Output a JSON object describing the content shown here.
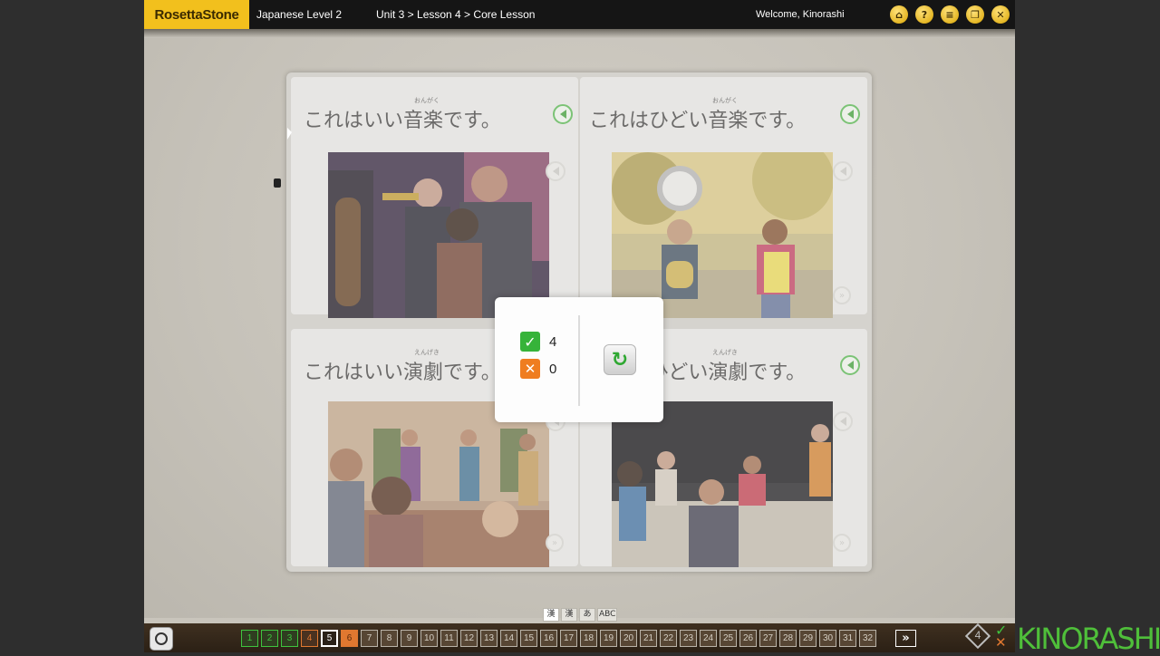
{
  "header": {
    "logo": "RosettaStone",
    "course": "Japanese Level 2",
    "breadcrumb": "Unit 3 > Lesson 4 > Core Lesson",
    "welcome": "Welcome, Kinorashi",
    "icons": [
      "home-icon",
      "help-icon",
      "menu-list-icon",
      "window-icon",
      "close-icon"
    ]
  },
  "cards": [
    {
      "text": "これはいい音楽です。",
      "furigana": "おんがく"
    },
    {
      "text": "これはひどい音楽です。",
      "furigana": "おんがく"
    },
    {
      "text": "これはいい演劇です。",
      "furigana": "えんげき"
    },
    {
      "text": "これはひどい演劇です。",
      "furigana": "えんげき"
    }
  ],
  "result": {
    "correct": "4",
    "incorrect": "0"
  },
  "script_selector": [
    "漢",
    "漢",
    "あ",
    "ABC"
  ],
  "pages": {
    "items": [
      "1",
      "2",
      "3",
      "4",
      "5",
      "6",
      "7",
      "8",
      "9",
      "10",
      "11",
      "12",
      "13",
      "14",
      "15",
      "16",
      "17",
      "18",
      "19",
      "20",
      "21",
      "22",
      "23",
      "24",
      "25",
      "26",
      "27",
      "28",
      "29",
      "30",
      "31",
      "32"
    ],
    "done": [
      "1",
      "2",
      "3"
    ],
    "error": [
      "4"
    ],
    "current": "5",
    "next": "6",
    "forward": "»"
  },
  "score_badge": "4",
  "brand_watermark": "KINORASHI",
  "colors": {
    "accent_yellow": "#f2c01d",
    "correct_green": "#36b33a",
    "incorrect_orange": "#ef7d20"
  }
}
